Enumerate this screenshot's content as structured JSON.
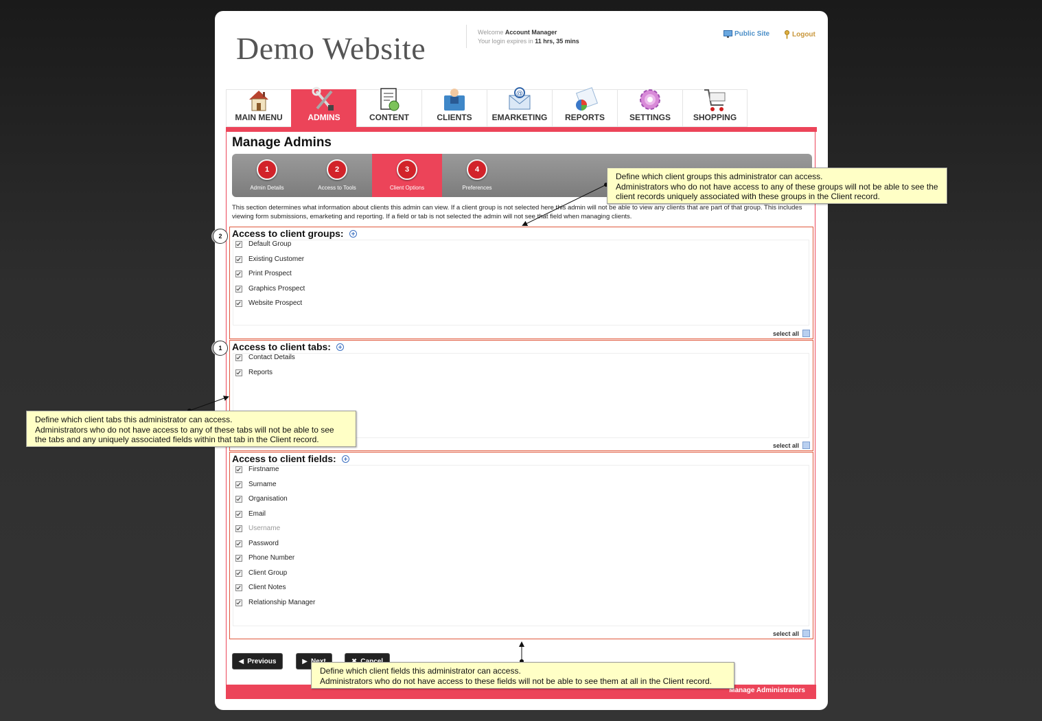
{
  "header": {
    "logo": "Demo Website",
    "welcome_prefix": "Welcome",
    "user_name": "Account Manager",
    "login_prefix": "Your login expires in",
    "login_time": "11 hrs, 35 mins",
    "public_site": "Public Site",
    "logout": "Logout"
  },
  "nav": [
    {
      "label": "MAIN MENU",
      "icon": "house-icon"
    },
    {
      "label": "ADMINS",
      "icon": "tools-icon",
      "active": true
    },
    {
      "label": "CONTENT",
      "icon": "document-icon"
    },
    {
      "label": "CLIENTS",
      "icon": "clients-icon"
    },
    {
      "label": "EMARKETING",
      "icon": "email-icon"
    },
    {
      "label": "REPORTS",
      "icon": "reports-icon"
    },
    {
      "label": "SETTINGS",
      "icon": "gear-icon"
    },
    {
      "label": "SHOPPING",
      "icon": "cart-icon"
    }
  ],
  "page_title": "Manage Admins",
  "wizard": [
    {
      "num": "1",
      "label": "Admin Details"
    },
    {
      "num": "2",
      "label": "Access to Tools"
    },
    {
      "num": "3",
      "label": "Client Options",
      "active": true
    },
    {
      "num": "4",
      "label": "Preferences"
    }
  ],
  "intro": "This section determines what information about clients this admin can view. If a client group is not selected here this admin will not be able to view any clients that are part of that group. This includes viewing form submissions, emarketing and reporting. If a field or tab is not selected the admin will not see that field when managing clients.",
  "groups": {
    "title": "Access to client groups:",
    "items": [
      "Default Group",
      "Existing Customer",
      "Print Prospect",
      "Graphics Prospect",
      "Website Prospect"
    ],
    "select_all": "select all"
  },
  "tabs": {
    "title": "Access to client tabs:",
    "items": [
      "Contact Details",
      "Reports"
    ],
    "select_all": "select all"
  },
  "fields": {
    "title": "Access to client fields:",
    "items": [
      "Firstname",
      "Surname",
      "Organisation",
      "Email",
      "Username",
      "Password",
      "Phone Number",
      "Client Group",
      "Client Notes",
      "Relationship Manager"
    ],
    "select_all": "select all"
  },
  "buttons": {
    "previous": "Previous",
    "next": "Next",
    "cancel": "Cancel"
  },
  "footer": "Manage Administrators",
  "markers": {
    "groups": "2",
    "tabs": "1"
  },
  "callouts": {
    "groups": {
      "line1": "Define which client groups this administrator can access.",
      "line2": "Administrators who do not have access to any of these groups will not be able to see the client records uniquely associated with these groups in the Client record."
    },
    "tabs": {
      "line1": "Define which client tabs this administrator can access.",
      "line2": "Administrators who do not have access to any of these tabs will not be able to see the tabs and any uniquely associated fields within that tab in the Client record."
    },
    "fields": {
      "line1": "Define which client fields this administrator can access.",
      "line2": "Administrators who do not have access to these fields will not be able to see them at all in the Client record."
    }
  },
  "colors": {
    "accent": "#ec4459",
    "section_border": "#e0573a",
    "callout_bg": "#ffffc6"
  }
}
